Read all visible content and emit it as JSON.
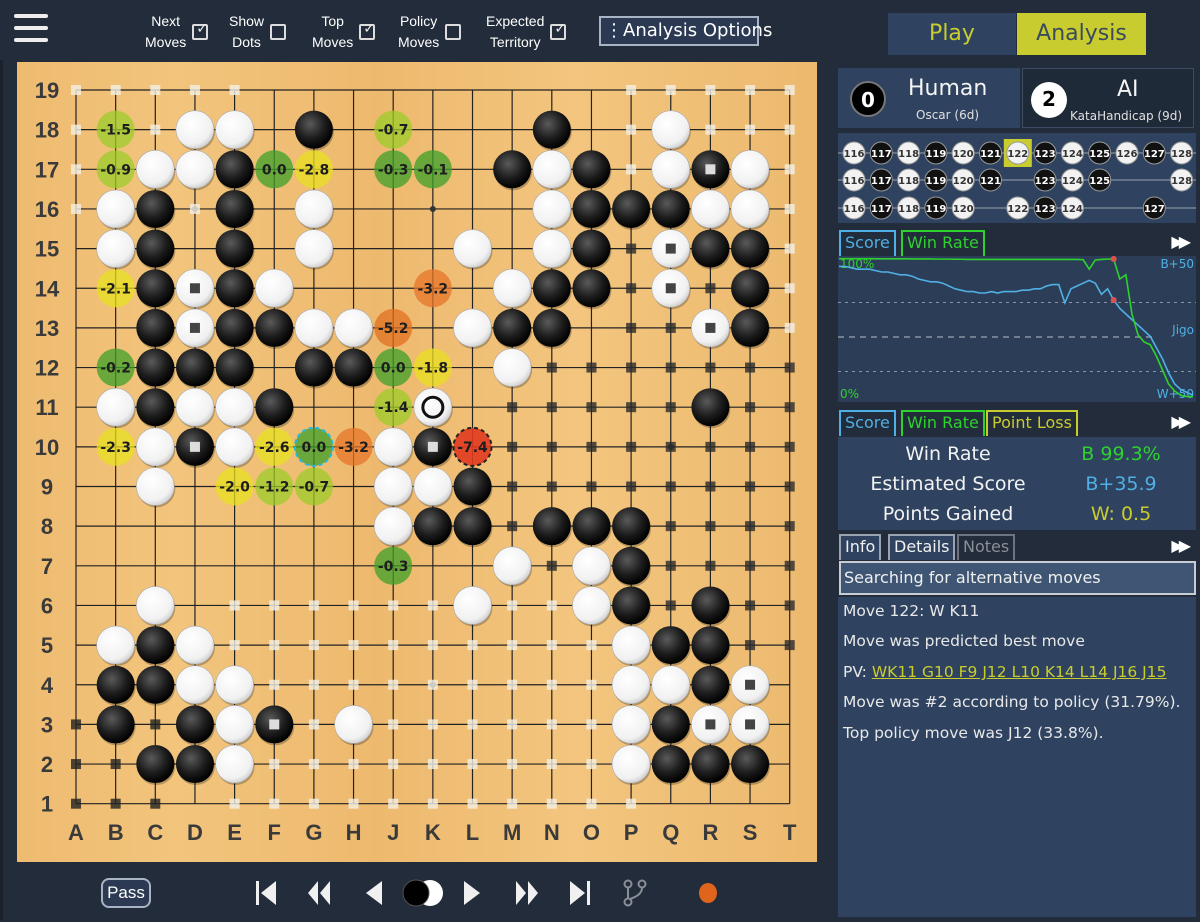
{
  "toolbar": {
    "menu_icon": "hamburger-menu-icon",
    "toggles": [
      {
        "label_line1": "Next",
        "label_line2": "Moves",
        "checked": true
      },
      {
        "label_line1": "Show",
        "label_line2": "Dots",
        "checked": false
      },
      {
        "label_line1": "Top",
        "label_line2": "Moves",
        "checked": true
      },
      {
        "label_line1": "Policy",
        "label_line2": "Moves",
        "checked": false
      },
      {
        "label_line1": "Expected",
        "label_line2": "Territory",
        "checked": true
      }
    ],
    "analysis_options_label": "⋮Analysis Options"
  },
  "mode_tabs": {
    "play": "Play",
    "analysis": "Analysis",
    "active": "analysis"
  },
  "players": {
    "black": {
      "captures": "0",
      "type": "Human",
      "name": "Oscar (6d)"
    },
    "white": {
      "captures": "2",
      "type": "AI",
      "name": "KataHandicap (9d)"
    }
  },
  "move_tree": {
    "rows": [
      {
        "nodes": [
          [
            116,
            "W"
          ],
          [
            117,
            "B"
          ],
          [
            118,
            "W"
          ],
          [
            119,
            "B"
          ],
          [
            120,
            "W"
          ],
          [
            121,
            "B"
          ],
          [
            122,
            "W"
          ],
          [
            123,
            "B"
          ],
          [
            124,
            "W"
          ],
          [
            125,
            "B"
          ],
          [
            126,
            "W"
          ],
          [
            127,
            "B"
          ],
          [
            128,
            "W"
          ]
        ]
      },
      {
        "nodes": [
          [
            116,
            "W"
          ],
          [
            117,
            "B"
          ],
          [
            118,
            "W"
          ],
          [
            119,
            "B"
          ],
          [
            120,
            "W"
          ],
          [
            121,
            "B"
          ],
          [
            123,
            "B"
          ],
          [
            124,
            "W"
          ],
          [
            125,
            "B"
          ],
          [
            128,
            "W"
          ]
        ]
      },
      {
        "nodes": [
          [
            116,
            "W"
          ],
          [
            117,
            "B"
          ],
          [
            118,
            "W"
          ],
          [
            119,
            "B"
          ],
          [
            120,
            "W"
          ],
          [
            122,
            "W"
          ],
          [
            123,
            "B"
          ],
          [
            124,
            "W"
          ],
          [
            127,
            "B"
          ]
        ]
      }
    ],
    "selected_move": 122
  },
  "graph_tabs": {
    "score": "Score",
    "win_rate": "Win Rate"
  },
  "graph": {
    "labels": {
      "top_left": "100%",
      "bottom_left": "0%",
      "top_right": "B+50",
      "mid_right": "Jigo",
      "bottom_right": "W+50"
    },
    "colors": {
      "score": "#4fb0e6",
      "win_rate": "#2ed12e",
      "marker": "#e05050"
    },
    "win_rate_series": [
      99.5,
      99.5,
      99.5,
      99.5,
      99.5,
      99.5,
      99.4,
      99.4,
      99.4,
      99.4,
      99.4,
      99.4,
      99.3,
      99.3,
      99.3,
      99.3,
      99.2,
      99.2,
      99.2,
      99.1,
      99.1,
      99.0,
      99.0,
      99.0,
      99.0,
      99.0,
      99.0,
      99.0,
      99.0,
      99.0,
      99.0,
      99.0,
      99.0,
      99.0,
      99.0,
      99.0,
      99.0,
      99.0,
      99.0,
      99.0,
      98.8,
      92,
      98.6,
      99.0,
      99.2,
      99.3,
      85,
      88,
      60,
      45,
      40,
      38,
      30,
      20,
      10,
      5,
      2,
      1,
      1
    ],
    "score_series": [
      44,
      44,
      43,
      42,
      42,
      42,
      41,
      40,
      40,
      39,
      38,
      38,
      37,
      35,
      34,
      33,
      33,
      32,
      30,
      28,
      27,
      26,
      26,
      25,
      25,
      26,
      25,
      26,
      26,
      26,
      27,
      27,
      28,
      28,
      30,
      31,
      31,
      18,
      28,
      30,
      32,
      34,
      32,
      24,
      28,
      20,
      14,
      10,
      6,
      2,
      -2,
      -6,
      -14,
      -22,
      -32,
      -40,
      -44,
      -46,
      -48
    ],
    "marker_index": 41
  },
  "stat_tabs": {
    "score": "Score",
    "win_rate": "Win Rate",
    "point_loss": "Point Loss"
  },
  "stats": [
    {
      "label": "Win Rate",
      "value": "B 99.3%",
      "color": "#2ed12e"
    },
    {
      "label": "Estimated Score",
      "value": "B+35.9",
      "color": "#4fb0e6"
    },
    {
      "label": "Points Gained",
      "value": "W: 0.5",
      "color": "#c9cc2e"
    }
  ],
  "info_tabs": {
    "info": "Info",
    "details": "Details",
    "notes": "Notes"
  },
  "status": "Searching for alternative moves",
  "info": {
    "move": "Move 122: W K11",
    "predicted": "Move was predicted best move",
    "pv_label": "PV: ",
    "pv": "WK11 G10 F9 J12 L10 K14 L14 J16 J15",
    "policy_rank": "Move was #2 according to policy  (31.79%).",
    "top_policy": "Top policy move was J12 (33.8%)."
  },
  "bottom": {
    "pass_label": "Pass",
    "nav_icons": [
      "first-move-icon",
      "back-ten-icon",
      "back-one-icon",
      "turn-indicator-icon",
      "forward-one-icon",
      "forward-ten-icon",
      "last-move-icon",
      "branch-icon",
      "record-icon"
    ]
  },
  "board": {
    "size": 19,
    "col_labels": [
      "A",
      "B",
      "C",
      "D",
      "E",
      "F",
      "G",
      "H",
      "J",
      "K",
      "L",
      "M",
      "N",
      "O",
      "P",
      "Q",
      "R",
      "S",
      "T"
    ],
    "row_labels": [
      "19",
      "18",
      "17",
      "16",
      "15",
      "14",
      "13",
      "12",
      "11",
      "10",
      "9",
      "8",
      "7",
      "6",
      "5",
      "4",
      "3",
      "2",
      "1"
    ],
    "last_move": "K11",
    "black": [
      "G18",
      "N18",
      "E17",
      "M17",
      "O17",
      "R17",
      "C16",
      "E16",
      "O16",
      "P16",
      "Q16",
      "C15",
      "E15",
      "O15",
      "R15",
      "S15",
      "C14",
      "E14",
      "N14",
      "O14",
      "S14",
      "C13",
      "E13",
      "F13",
      "M13",
      "N13",
      "S13",
      "C12",
      "D12",
      "E12",
      "G12",
      "H12",
      "C11",
      "F11",
      "R11",
      "D10",
      "K10",
      "L9",
      "K8",
      "L8",
      "N8",
      "O8",
      "P8",
      "P7",
      "P6",
      "R6",
      "C5",
      "Q5",
      "R5",
      "B4",
      "C4",
      "R4",
      "B3",
      "D3",
      "F3",
      "Q3",
      "C2",
      "D2",
      "Q2",
      "R2",
      "S2"
    ],
    "white": [
      "D18",
      "E18",
      "Q18",
      "C17",
      "D17",
      "N17",
      "Q17",
      "S17",
      "B16",
      "G16",
      "N16",
      "R16",
      "S16",
      "B15",
      "G15",
      "L15",
      "N15",
      "Q15",
      "D14",
      "F14",
      "M14",
      "Q14",
      "D13",
      "G13",
      "H13",
      "L13",
      "R13",
      "M12",
      "B11",
      "D11",
      "E11",
      "K11",
      "C10",
      "E10",
      "J10",
      "C9",
      "J9",
      "K9",
      "J8",
      "M7",
      "O7",
      "C6",
      "L6",
      "O6",
      "B5",
      "D5",
      "P5",
      "D4",
      "E4",
      "P4",
      "Q4",
      "S4",
      "E3",
      "H3",
      "P3",
      "R3",
      "S3",
      "E2",
      "P2"
    ],
    "marked_stones": [
      "R17",
      "Q15",
      "D14",
      "Q14",
      "D13",
      "R13",
      "D10",
      "K10",
      "S4",
      "F3",
      "R3",
      "S3"
    ],
    "hints": [
      {
        "pt": "B18",
        "v": "-1.5"
      },
      {
        "pt": "J18",
        "v": "-0.7"
      },
      {
        "pt": "B17",
        "v": "-0.9"
      },
      {
        "pt": "F17",
        "v": "0.0"
      },
      {
        "pt": "G17",
        "v": "-2.8"
      },
      {
        "pt": "J17",
        "v": "-0.3"
      },
      {
        "pt": "K17",
        "v": "-0.1"
      },
      {
        "pt": "B14",
        "v": "-2.1"
      },
      {
        "pt": "K14",
        "v": "-3.2"
      },
      {
        "pt": "J13",
        "v": "-5.2"
      },
      {
        "pt": "B12",
        "v": "-0.2"
      },
      {
        "pt": "J12",
        "v": "0.0"
      },
      {
        "pt": "K12",
        "v": "-1.8"
      },
      {
        "pt": "J11",
        "v": "-1.4"
      },
      {
        "pt": "B10",
        "v": "-2.3"
      },
      {
        "pt": "F10",
        "v": "-2.6"
      },
      {
        "pt": "G10",
        "v": "0.0",
        "best": true
      },
      {
        "pt": "H10",
        "v": "-3.2"
      },
      {
        "pt": "L10",
        "v": "-7.4",
        "played": true
      },
      {
        "pt": "E9",
        "v": "-2.0"
      },
      {
        "pt": "F9",
        "v": "-1.2"
      },
      {
        "pt": "G9",
        "v": "-0.7"
      },
      {
        "pt": "J7",
        "v": "-0.3"
      }
    ]
  }
}
